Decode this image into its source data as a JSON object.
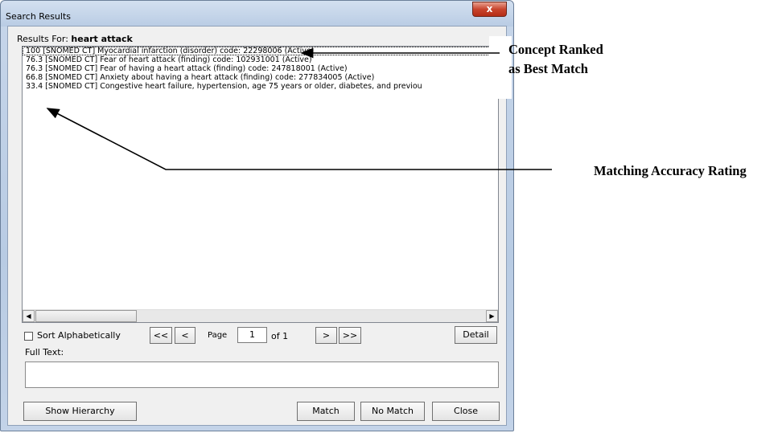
{
  "window": {
    "title": "Search Results",
    "close_glyph": "x"
  },
  "results": {
    "label_prefix": "Results For:",
    "query": "heart attack",
    "rows": [
      "100 [SNOMED CT] Myocardial infarction (disorder) code: 22298006 (Active)",
      "76.3 [SNOMED CT] Fear of heart attack (finding) code: 102931001 (Active)",
      "76.3 [SNOMED CT] Fear of having a heart attack (finding) code: 247818001 (Active)",
      "66.8 [SNOMED CT] Anxiety about having a heart attack (finding) code: 277834005 (Active)",
      "33.4 [SNOMED CT] Congestive heart failure, hypertension, age 75 years or older, diabetes, and previou"
    ]
  },
  "controls": {
    "sort_label": "Sort Alphabetically",
    "first": "<<",
    "prev": "<",
    "page_label": "Page",
    "page_value": "1",
    "of_label": "of 1",
    "next": ">",
    "last": ">>",
    "detail": "Detail",
    "full_text_label": "Full Text:"
  },
  "buttons": {
    "show_hierarchy": "Show Hierarchy",
    "match": "Match",
    "no_match": "No Match",
    "close": "Close"
  },
  "annotations": {
    "concept_line1": "Concept Ranked",
    "concept_line2": "as Best Match",
    "accuracy": "Matching Accuracy Rating"
  }
}
